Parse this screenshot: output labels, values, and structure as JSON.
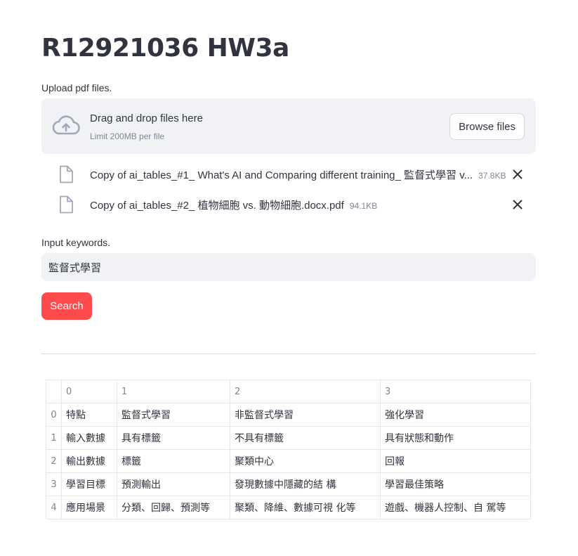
{
  "app": {
    "title": "R12921036 HW3a"
  },
  "uploader": {
    "label": "Upload pdf files.",
    "drop_text": "Drag and drop files here",
    "limit_text": "Limit 200MB per file",
    "browse_label": "Browse files",
    "icon": "cloud-upload-icon",
    "files": [
      {
        "name": "Copy of ai_tables_#1_ What's AI and Comparing different training_ 監督式學習 v...",
        "size": "37.8KB"
      },
      {
        "name": "Copy of ai_tables_#2_ 植物細胞 vs. 動物細胞.docx.pdf",
        "size": "94.1KB"
      }
    ]
  },
  "keywords": {
    "label": "Input keywords.",
    "value": "監督式學習"
  },
  "search": {
    "label": "Search"
  },
  "result_table": {
    "columns": [
      "",
      "0",
      "1",
      "2",
      "3"
    ],
    "rows": [
      {
        "index": "0",
        "cells": [
          "特點",
          "監督式學習",
          "非監督式學習",
          "強化學習"
        ]
      },
      {
        "index": "1",
        "cells": [
          "輸入數據",
          "具有標籤",
          "不具有標籤",
          "具有狀態和動作"
        ]
      },
      {
        "index": "2",
        "cells": [
          "輸出數據",
          "標籤",
          "聚類中心",
          "回報"
        ]
      },
      {
        "index": "3",
        "cells": [
          "學習目標",
          "預測輸出",
          "發現數據中隱藏的結 構",
          "學習最佳策略"
        ]
      },
      {
        "index": "4",
        "cells": [
          "應用場景",
          "分類、回歸、預測等",
          "聚類、降維、數據可視 化等",
          "遊戲、機器人控制、自 駕等"
        ]
      }
    ]
  },
  "colors": {
    "primary": "#ff4b4b",
    "input_bg": "#f0f2f6",
    "text": "#31333f",
    "muted": "#808495"
  }
}
